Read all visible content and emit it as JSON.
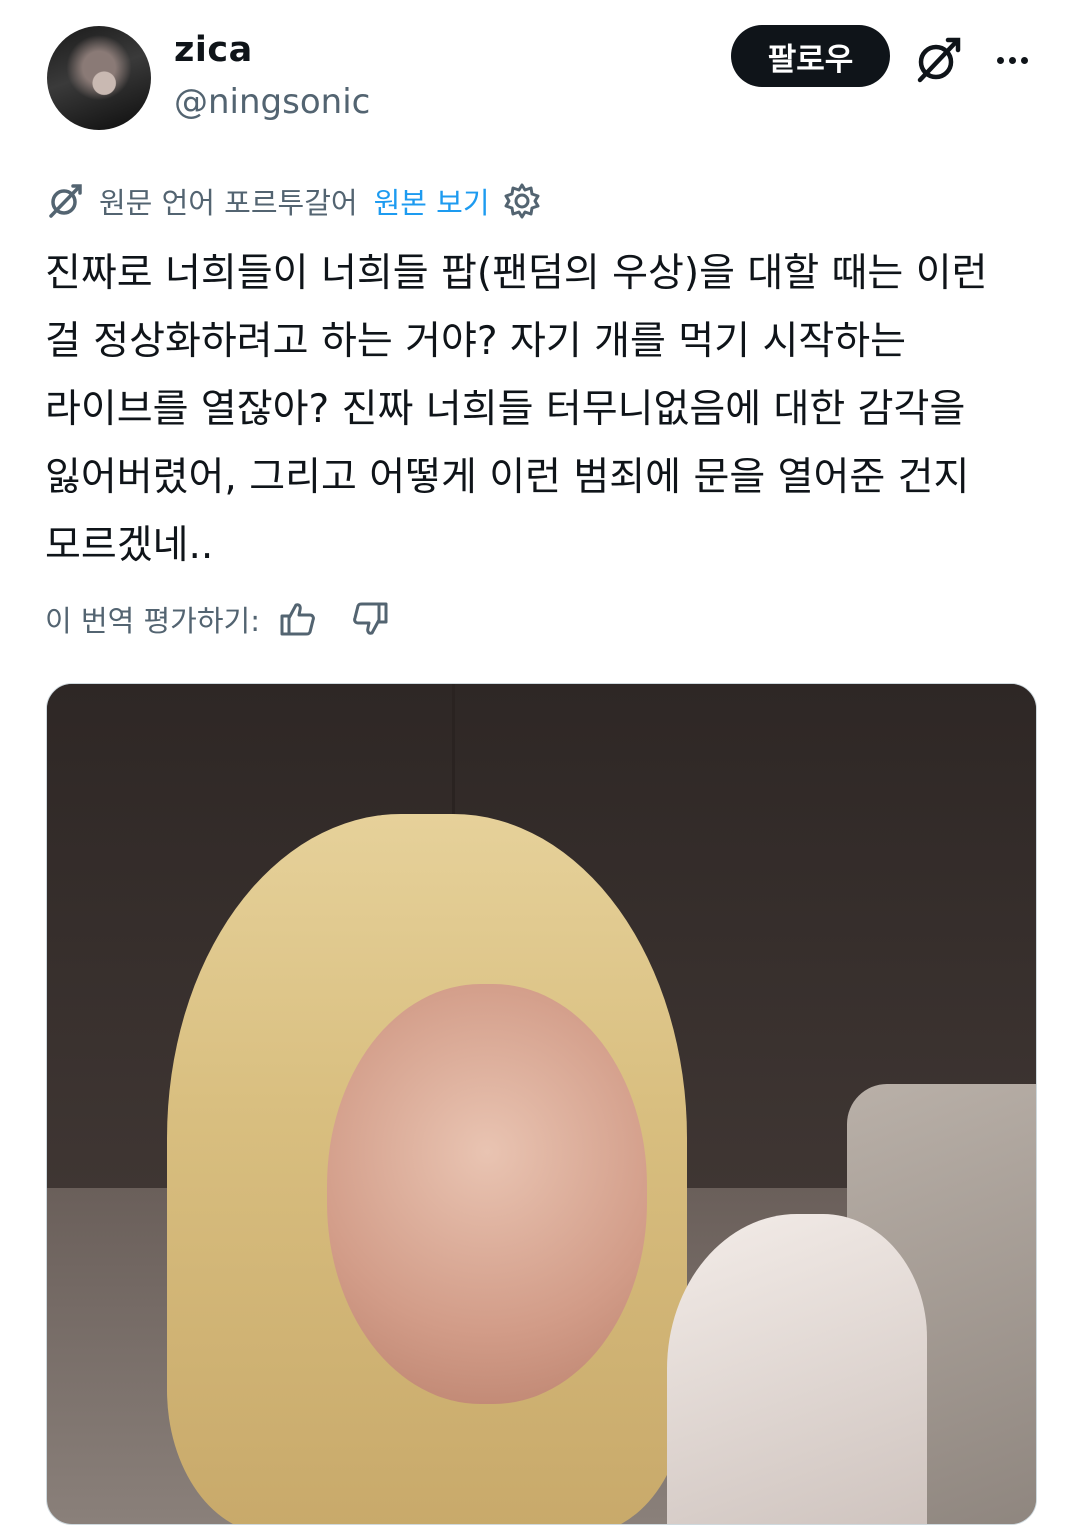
{
  "user": {
    "name": "zica",
    "handle": "@ningsonic"
  },
  "actions": {
    "follow_label": "팔로우"
  },
  "translation": {
    "source_language": "원문 언어 포르투갈어",
    "show_original_label": "원본 보기"
  },
  "tweet": {
    "text": "진짜로 너희들이 너희들 팝(팬덤의 우상)을 대할 때는 이런 걸 정상화하려고 하는 거야? 자기 개를 먹기 시작하는 라이브를 열잖아? 진짜 너희들 터무니없음에 대한 감각을 잃어버렸어, 그리고 어떻게 이런 범죄에 문을 열어준 건지 모르겠네.."
  },
  "rating": {
    "label": "이 번역 평가하기:"
  },
  "icons": {
    "grok": "grok-icon",
    "more": "more-icon",
    "translate": "translate-icon",
    "settings": "gear-icon",
    "thumbs_up": "thumbs-up-icon",
    "thumbs_down": "thumbs-down-icon"
  },
  "colors": {
    "text_primary": "#0f1419",
    "text_secondary": "#536471",
    "link": "#1d9bf0",
    "button_bg": "#0f1419"
  }
}
